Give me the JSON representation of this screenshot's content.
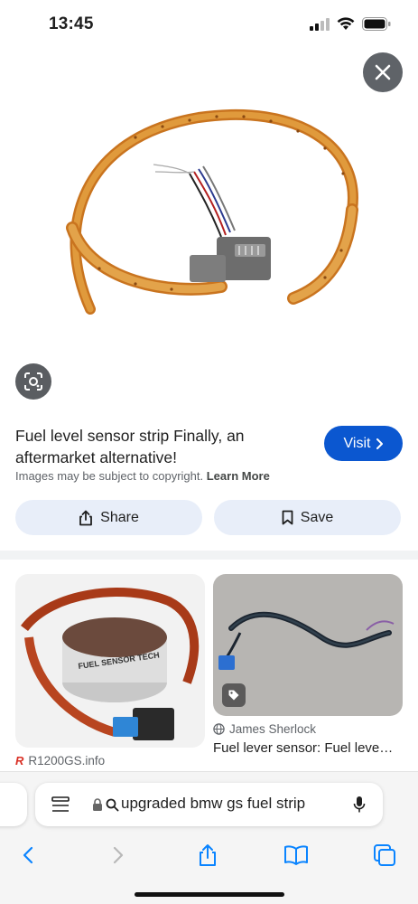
{
  "status_bar": {
    "time": "13:45"
  },
  "result": {
    "title": "Fuel level sensor strip Finally, an aftermarket alternative!",
    "visit_label": "Visit",
    "copyright_text": "Images may be subject to copyright.",
    "learn_more": "Learn More",
    "share_label": "Share",
    "save_label": "Save"
  },
  "related": [
    {
      "source": "R1200GS.info",
      "image_text": "FUEL SENSOR TECH"
    },
    {
      "source": "James Sherlock",
      "title": "Fuel lever sensor: Fuel leve…"
    }
  ],
  "browser": {
    "address_text": "upgraded bmw gs fuel strip"
  },
  "colors": {
    "accent": "#0b57d0",
    "button_bg": "#e8eef9",
    "close_bg": "#5f6368"
  },
  "icons": [
    "close-icon",
    "lens-icon",
    "chevron-right-icon",
    "share-icon",
    "bookmark-icon",
    "globe-icon",
    "tag-icon",
    "tab-icon",
    "lock-icon",
    "search-icon",
    "mic-icon",
    "back-icon",
    "forward-icon",
    "book-icon",
    "tabs-icon"
  ]
}
